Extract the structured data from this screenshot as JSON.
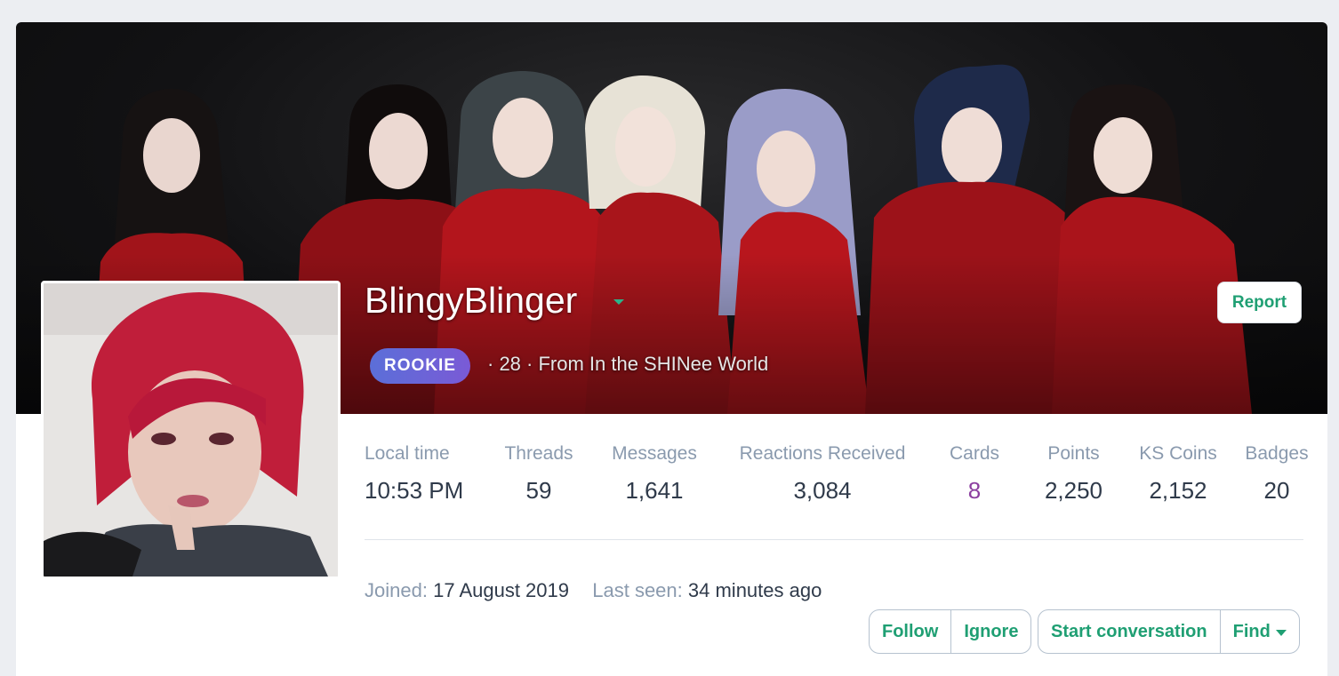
{
  "profile": {
    "username": "BlingyBlinger",
    "rank": "ROOKIE",
    "blurb": "· 28 · From In the SHINee World",
    "report_label": "Report"
  },
  "stats": [
    {
      "label": "Local time",
      "value": "10:53 PM"
    },
    {
      "label": "Threads",
      "value": "59"
    },
    {
      "label": "Messages",
      "value": "1,641"
    },
    {
      "label": "Reactions Received",
      "value": "3,084"
    },
    {
      "label": "Cards",
      "value": "8"
    },
    {
      "label": "Points",
      "value": "2,250"
    },
    {
      "label": "KS Coins",
      "value": "2,152"
    },
    {
      "label": "Badges",
      "value": "20"
    }
  ],
  "meta": {
    "joined_label": "Joined:",
    "joined_value": "17 August 2019",
    "last_seen_label": "Last seen:",
    "last_seen_value": "34 minutes ago"
  },
  "actions": {
    "follow": "Follow",
    "ignore": "Ignore",
    "start_conversation": "Start conversation",
    "find": "Find"
  },
  "colors": {
    "accent": "#1f9f73",
    "rank_badge": "#6366d8",
    "cards_value": "#8c3fa0"
  }
}
